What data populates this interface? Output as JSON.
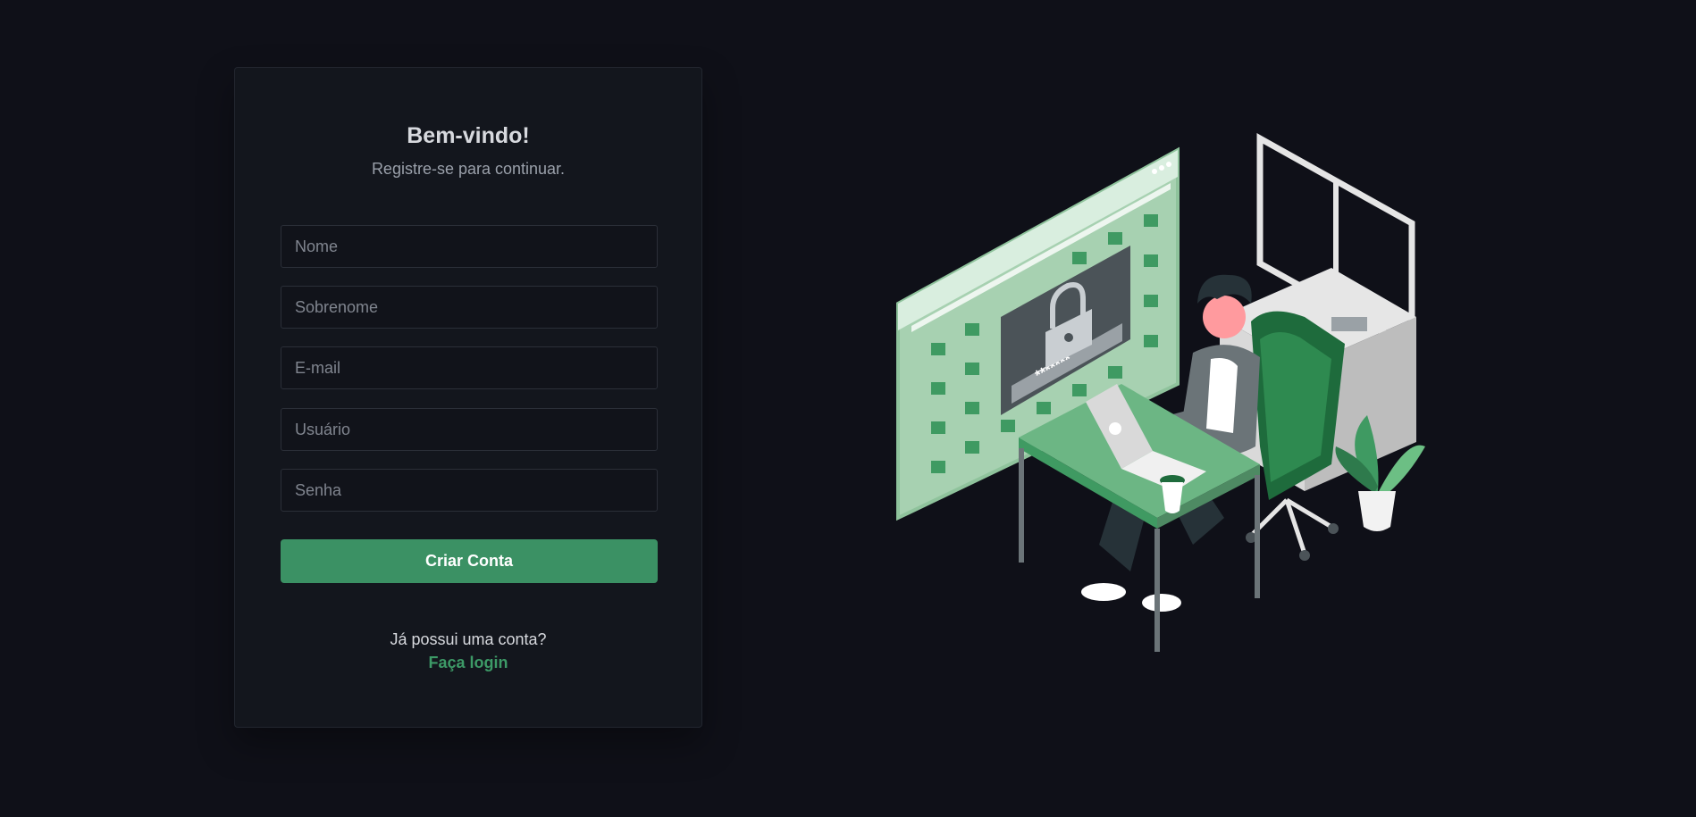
{
  "form": {
    "title": "Bem-vindo!",
    "subtitle": "Registre-se para continuar.",
    "fields": [
      {
        "placeholder": "Nome",
        "value": ""
      },
      {
        "placeholder": "Sobrenome",
        "value": ""
      },
      {
        "placeholder": "E-mail",
        "value": ""
      },
      {
        "placeholder": "Usuário",
        "value": ""
      },
      {
        "placeholder": "Senha",
        "value": ""
      }
    ],
    "submit_label": "Criar Conta",
    "login_prompt": "Já possui uma conta?",
    "login_link": "Faça login"
  },
  "illustration": {
    "password_mask": "*******"
  },
  "colors": {
    "background": "#0f1018",
    "card": "#13161d",
    "accent": "#3b9164",
    "link": "#3d9a67"
  }
}
